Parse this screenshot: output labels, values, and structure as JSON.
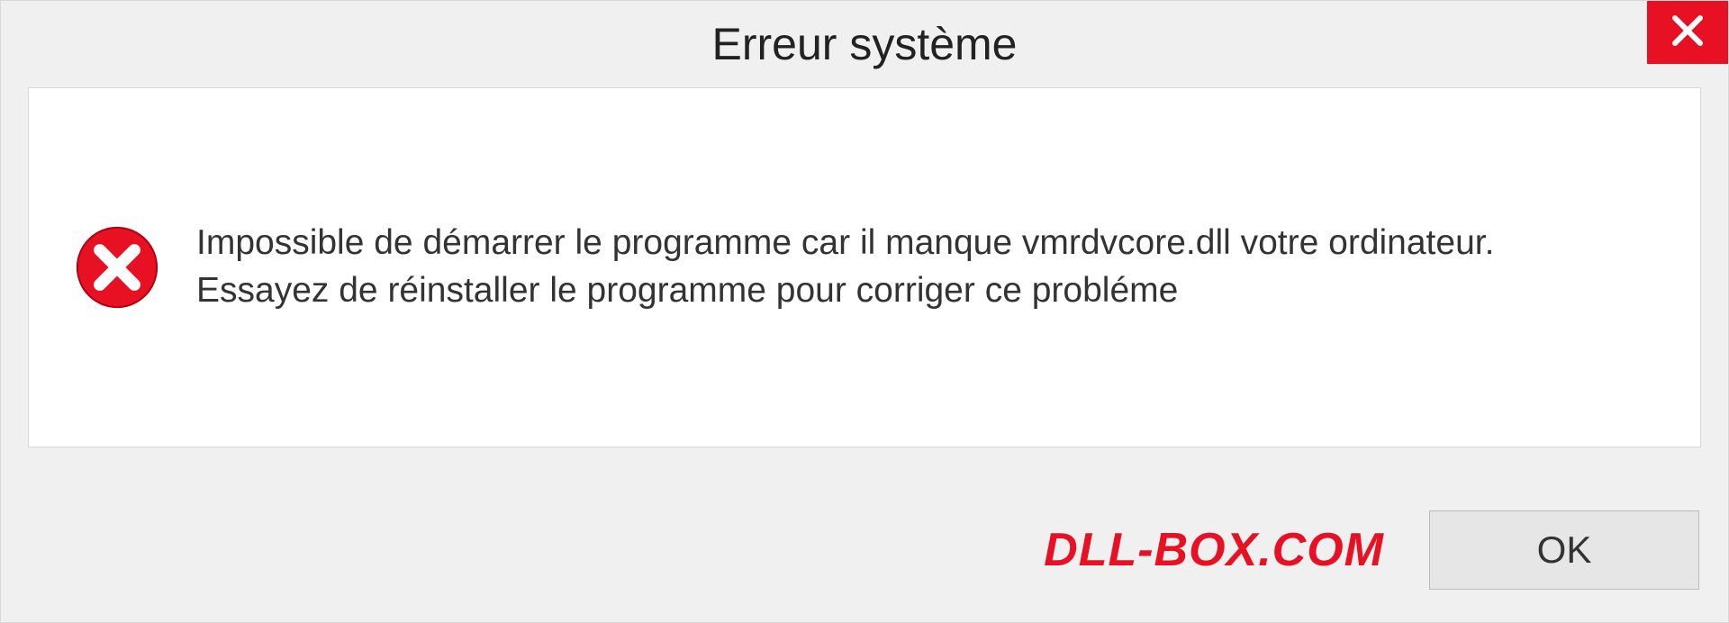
{
  "dialog": {
    "title": "Erreur système",
    "message": "Impossible de démarrer le programme car il manque vmrdvcore.dll votre ordinateur. Essayez de réinstaller le programme pour corriger ce probléme",
    "brand": "DLL-BOX.COM",
    "ok_label": "OK"
  }
}
